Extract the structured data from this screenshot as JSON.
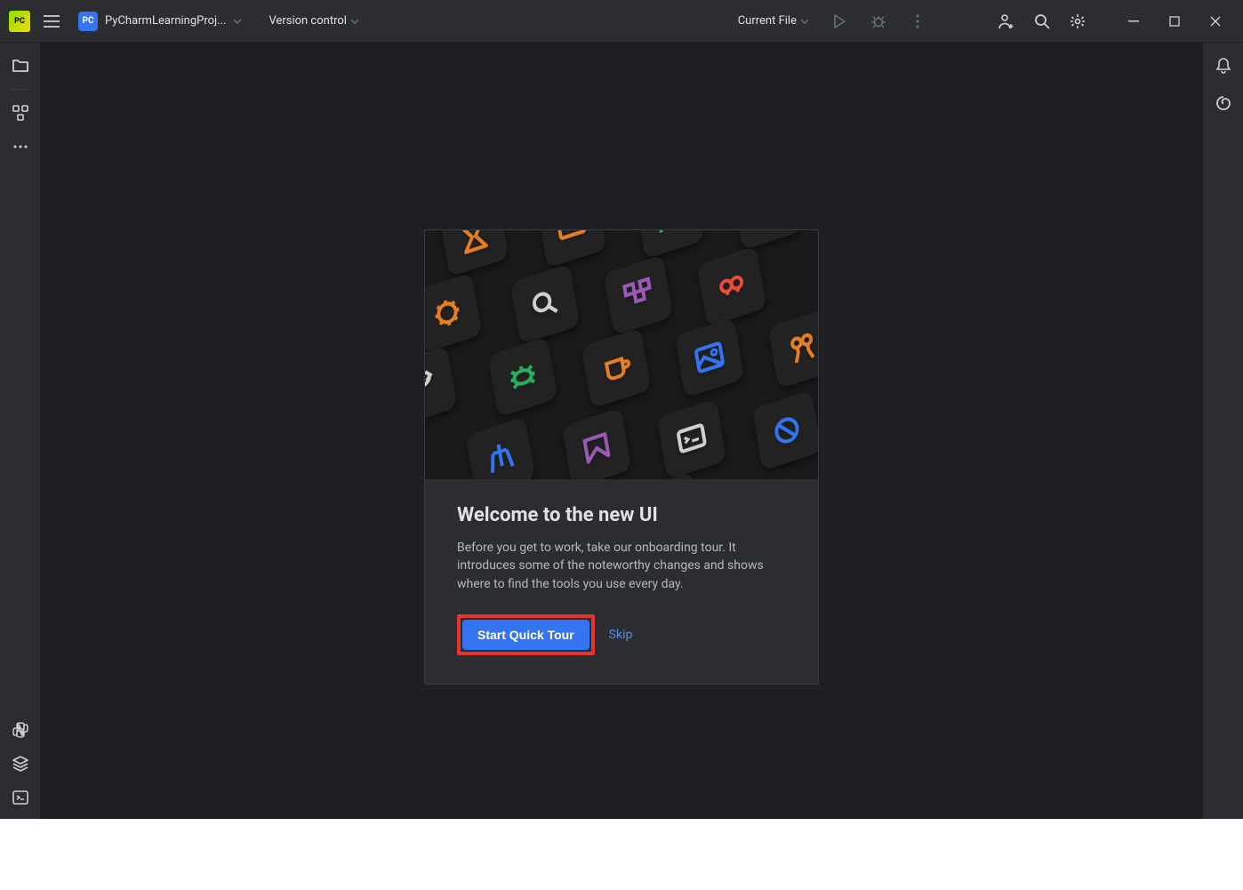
{
  "titlebar": {
    "project_badge": "PC",
    "project_name": "PyCharmLearningProj...",
    "version_control": "Version control",
    "current_file": "Current File"
  },
  "welcome": {
    "title": "Welcome to the new UI",
    "description": "Before you get to work, take our onboarding tour. It introduces some of the noteworthy changes and shows where to find the tools you use every day.",
    "primary_button": "Start Quick Tour",
    "skip_link": "Skip"
  }
}
